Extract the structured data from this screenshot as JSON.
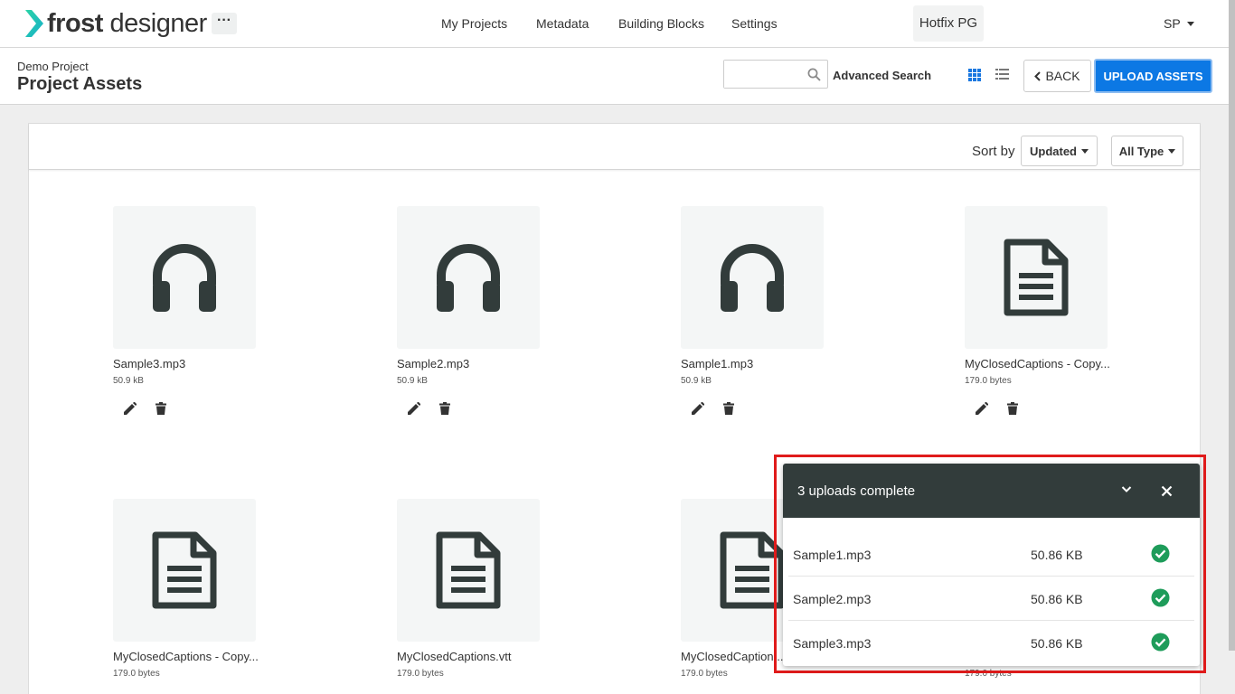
{
  "app": {
    "logo_bold": "frost",
    "logo_light": " designer",
    "more_label": "···"
  },
  "nav": {
    "items": [
      {
        "label": "My Projects"
      },
      {
        "label": "Metadata"
      },
      {
        "label": "Building Blocks"
      },
      {
        "label": "Settings"
      }
    ],
    "project": "Hotfix PG",
    "user": "SP"
  },
  "header": {
    "breadcrumb": "Demo Project",
    "title": "Project Assets",
    "search_value": "",
    "search_placeholder": "",
    "advanced_search": "Advanced Search",
    "back_label": "BACK",
    "upload_label": "UPLOAD ASSETS"
  },
  "toolbar": {
    "sort_label": "Sort by",
    "sort_value": "Updated",
    "type_value": "All Type"
  },
  "assets": [
    {
      "name": "Sample3.mp3",
      "size": "50.9 kB",
      "kind": "audio"
    },
    {
      "name": "Sample2.mp3",
      "size": "50.9 kB",
      "kind": "audio"
    },
    {
      "name": "Sample1.mp3",
      "size": "50.9 kB",
      "kind": "audio"
    },
    {
      "name": "MyClosedCaptions - Copy...",
      "size": "179.0 bytes",
      "kind": "document"
    },
    {
      "name": "MyClosedCaptions - Copy...",
      "size": "179.0 bytes",
      "kind": "document"
    },
    {
      "name": "MyClosedCaptions.vtt",
      "size": "179.0 bytes",
      "kind": "document"
    },
    {
      "name": "MyClosedCaption...",
      "size": "179.0 bytes",
      "kind": "document"
    },
    {
      "name": "",
      "size": "179.0 bytes",
      "kind": "document"
    }
  ],
  "toast": {
    "title": "3 uploads complete",
    "rows": [
      {
        "name": "Sample1.mp3",
        "size": "50.86 KB",
        "status": "complete"
      },
      {
        "name": "Sample2.mp3",
        "size": "50.86 KB",
        "status": "complete"
      },
      {
        "name": "Sample3.mp3",
        "size": "50.86 KB",
        "status": "complete"
      }
    ]
  },
  "colors": {
    "brand": "#1cc7a0",
    "primary_button": "#0c78e4",
    "toast_header": "#323c3b",
    "success": "#1e9c5a",
    "highlight": "#e01b1b"
  }
}
